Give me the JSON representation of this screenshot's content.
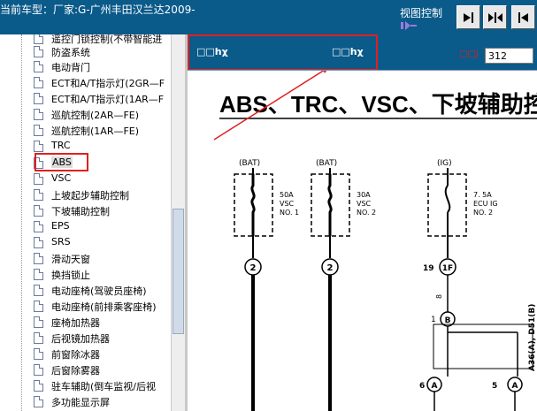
{
  "topbar": {
    "title": "当前车型：厂家:G-广州丰田汉兰达2009-",
    "view_control_label": "视图控制"
  },
  "tree": {
    "items": [
      {
        "label": "遥控门锁控制(不带智能进",
        "selected": false
      },
      {
        "label": "防盗系统",
        "selected": false
      },
      {
        "label": "电动背门",
        "selected": false
      },
      {
        "label": "ECT和A/T指示灯(2GR—F",
        "selected": false
      },
      {
        "label": "ECT和A/T指示灯(1AR—F",
        "selected": false
      },
      {
        "label": "巡航控制(2AR—FE)",
        "selected": false
      },
      {
        "label": "巡航控制(1AR—FE)",
        "selected": false
      },
      {
        "label": "TRC",
        "selected": false
      },
      {
        "label": "ABS",
        "selected": true
      },
      {
        "label": "VSC",
        "selected": false
      },
      {
        "label": "上坡起步辅助控制",
        "selected": false
      },
      {
        "label": "下坡辅助控制",
        "selected": false
      },
      {
        "label": "EPS",
        "selected": false
      },
      {
        "label": "SRS",
        "selected": false
      },
      {
        "label": "滑动天窗",
        "selected": false
      },
      {
        "label": "换挡锁止",
        "selected": false
      },
      {
        "label": "电动座椅(驾驶员座椅)",
        "selected": false
      },
      {
        "label": "电动座椅(前排乘客座椅)",
        "selected": false
      },
      {
        "label": "座椅加热器",
        "selected": false
      },
      {
        "label": "后视镜加热器",
        "selected": false
      },
      {
        "label": "前窗除冰器",
        "selected": false
      },
      {
        "label": "后窗除雾器",
        "selected": false
      },
      {
        "label": "驻车辅助(倒车监视/后视",
        "selected": false
      },
      {
        "label": "多功能显示屏",
        "selected": false
      }
    ]
  },
  "header": {
    "left_text": "□□hχ",
    "mid_text": "□□hχ",
    "page_label": "□□j",
    "page_value": "312"
  },
  "diagram": {
    "title": "ABS、TRC、VSC、下坡辅助控",
    "fuses": [
      {
        "source": "(BAT)",
        "rating": "50A",
        "line2": "VSC",
        "line3": "NO. 1",
        "terminal": "2"
      },
      {
        "source": "(BAT)",
        "rating": "30A",
        "line2": "VSC",
        "line3": "NO. 2",
        "terminal": "2"
      },
      {
        "source": "(IG)",
        "rating": "7. 5A",
        "line2": "ECU IG",
        "line3": "NO. 2",
        "terminal": "1F"
      }
    ],
    "pin_19": "19",
    "wire_b": "B",
    "pin_1": "1",
    "pin_8": "8",
    "connector_a1": "A",
    "connector_a2": "A",
    "pin_6": "6",
    "pin_5": "5",
    "side_label": "A36(A), D51(B)"
  },
  "colors": {
    "blue_bar": "#0a5a8a",
    "annotation_red": "#e02020"
  }
}
